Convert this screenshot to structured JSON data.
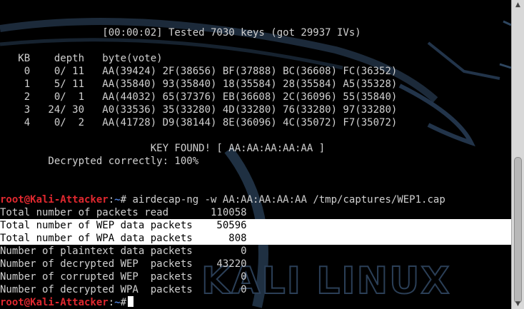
{
  "terminal": {
    "lines": [
      "                 [00:00:02] Tested 7030 keys (got 29937 IVs)",
      "",
      "   KB    depth   byte(vote)",
      "    0    0/ 11   AA(39424) 2F(38656) BF(37888) BC(36608) FC(36352)",
      "    1    5/ 11   AA(35840) 93(35840) 18(35584) 28(35584) A5(35328)",
      "    2    0/  1   AA(44032) 65(37376) EB(36608) 2C(36096) 55(35840)",
      "    3   24/ 30   A0(33536) 35(33280) 4D(33280) 76(33280) 97(33280)",
      "    4    0/  2   AA(41728) D9(38144) 8E(36096) 4C(35072) F7(35072)",
      "",
      "                         KEY FOUND! [ AA:AA:AA:AA:AA ]",
      "        Decrypted correctly: 100%"
    ],
    "command_prompt": {
      "user_host": "root@Kali-Attacker",
      "separator": ":",
      "path": "~",
      "symbol": "#",
      "command": " airdecap-ng -w AA:AA:AA:AA:AA /tmp/captures/WEP1.cap"
    },
    "output_lines": [
      "Total number of packets read       110058",
      "Total number of WEP data packets    50596",
      "Total number of WPA data packets      808",
      "Number of plaintext data packets        0",
      "Number of decrypted WEP  packets    43220",
      "Number of corrupted WEP  packets        0",
      "Number of decrypted WPA  packets        0"
    ],
    "final_prompt": {
      "user_host": "root@Kali-Attacker",
      "separator": ":",
      "path": "~",
      "symbol": "#"
    }
  },
  "watermark": "KALI LINUX",
  "colors": {
    "background": "#000000",
    "text": "#d0d0d0",
    "prompt_user": "#e0282f",
    "prompt_path": "#4f7fd6",
    "highlight": "#ffffff"
  }
}
